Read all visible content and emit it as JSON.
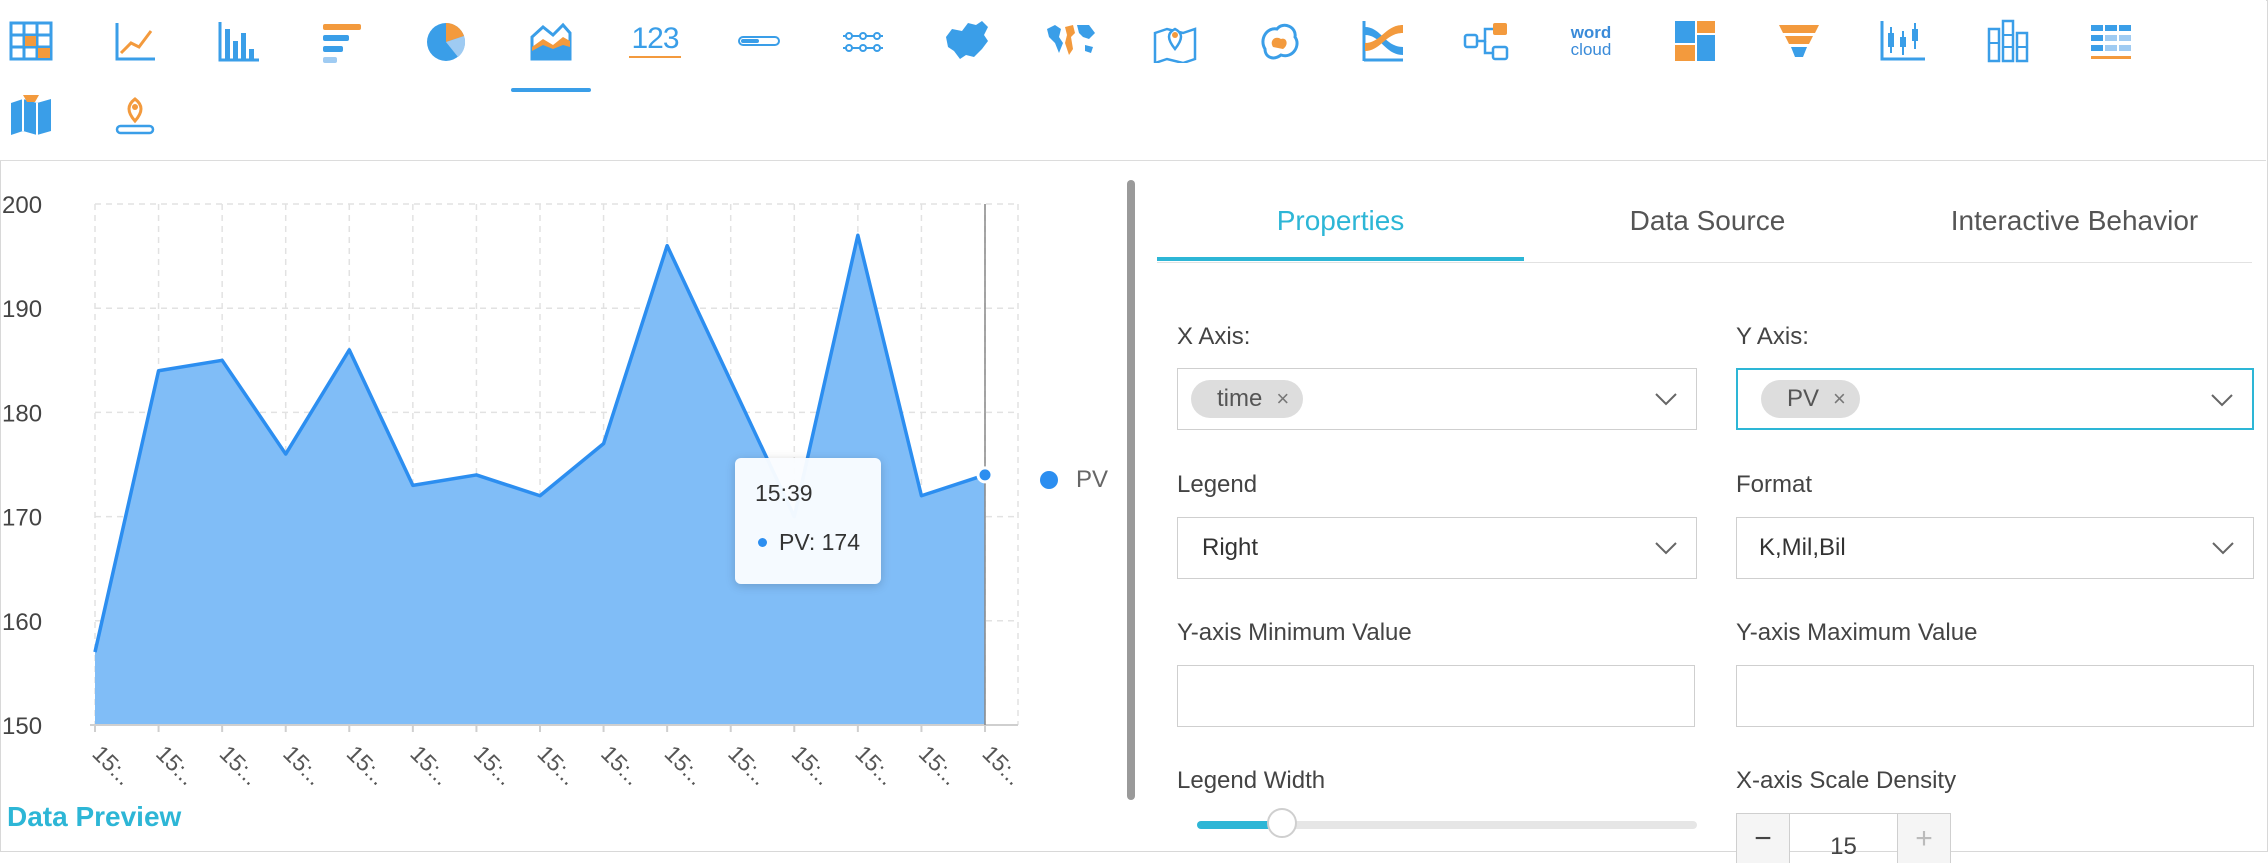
{
  "toolbar": {
    "icons": [
      {
        "name": "table-chart-icon"
      },
      {
        "name": "line-chart-icon"
      },
      {
        "name": "bar-chart-icon"
      },
      {
        "name": "horizontal-bar-chart-icon"
      },
      {
        "name": "pie-chart-icon"
      },
      {
        "name": "area-chart-icon",
        "active": true
      },
      {
        "name": "number-card-icon",
        "text": "123"
      },
      {
        "name": "progress-bar-icon"
      },
      {
        "name": "timeline-icon"
      },
      {
        "name": "china-map-icon"
      },
      {
        "name": "world-map-icon"
      },
      {
        "name": "location-map-icon"
      },
      {
        "name": "region-heatmap-icon"
      },
      {
        "name": "sankey-icon"
      },
      {
        "name": "tree-graph-icon"
      },
      {
        "name": "word-cloud-icon",
        "text_line1": "word",
        "text_line2": "cloud"
      },
      {
        "name": "treemap-icon"
      },
      {
        "name": "funnel-icon"
      },
      {
        "name": "candlestick-icon"
      },
      {
        "name": "stacked-bar-icon"
      },
      {
        "name": "cross-table-icon"
      },
      {
        "name": "folded-map-icon"
      },
      {
        "name": "location-pin-icon"
      }
    ],
    "accent_blue": "#3a9ee8",
    "accent_orange": "#f39a3d"
  },
  "chart_data": {
    "type": "area",
    "x": [
      "15:..",
      "15:..",
      "15:..",
      "15:..",
      "15:..",
      "15:..",
      "15:..",
      "15:..",
      "15:..",
      "15:..",
      "15:..",
      "15:..",
      "15:..",
      "15:..",
      "15:.."
    ],
    "series": [
      {
        "name": "PV",
        "values": [
          157,
          184,
          185,
          176,
          186,
          173,
          174,
          172,
          177,
          196,
          183,
          170,
          197,
          172,
          174
        ],
        "color": "#2c8ef0",
        "fill": "#80bdf7"
      }
    ],
    "ylim": [
      150,
      200
    ],
    "yticks": [
      150,
      160,
      170,
      180,
      190,
      200
    ],
    "grid": true,
    "legend": "right",
    "tooltip": {
      "title": "15:39",
      "series": "PV",
      "value": "174",
      "index": 14
    }
  },
  "tooltip_text": {
    "title": "15:39",
    "row": "PV: 174"
  },
  "legend": {
    "label": "PV"
  },
  "data_preview_label": "Data Preview",
  "panel": {
    "tabs": [
      {
        "label": "Properties",
        "active": true
      },
      {
        "label": "Data Source"
      },
      {
        "label": "Interactive Behavior"
      }
    ],
    "x_axis": {
      "label": "X Axis:",
      "chip": "time"
    },
    "y_axis": {
      "label": "Y Axis:",
      "chip": "PV"
    },
    "legend_field": {
      "label": "Legend",
      "value": "Right"
    },
    "format_field": {
      "label": "Format",
      "value": "K,Mil,Bil"
    },
    "y_min": {
      "label": "Y-axis Minimum Value",
      "value": ""
    },
    "y_max": {
      "label": "Y-axis Maximum Value",
      "value": ""
    },
    "legend_width": {
      "label": "Legend Width",
      "fraction": 0.17
    },
    "x_density": {
      "label": "X-axis Scale Density",
      "value": "15",
      "minus": "−",
      "plus": "+"
    },
    "chip_remove": "×"
  },
  "colors": {
    "teal": "#2db6d6",
    "series_blue": "#2c8ef0",
    "area_fill": "#80bdf7"
  }
}
